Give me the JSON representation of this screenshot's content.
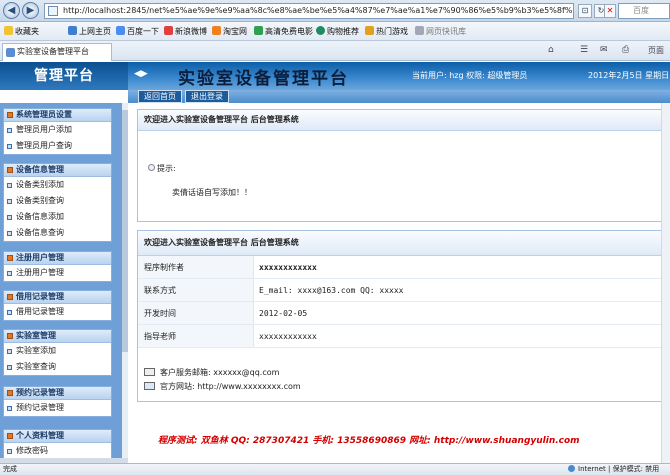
{
  "browser": {
    "url": "http://localhost:2845/net%e5%ae%9e%e9%aa%8c%e8%ae%be%e5%a4%87%e7%ae%a1%e7%90%86%e5%b9%b3%e5%8f%b0sh",
    "search_placeholder": "百度",
    "tab_title": "实验室设备管理平台",
    "favorites_label": "收藏夹",
    "favorites": [
      "上网主页",
      "百度一下",
      "新浪微博",
      "淘宝网",
      "高清免费电影",
      "购物推荐",
      "热门游戏",
      "网页快讯库"
    ],
    "page_menu": "页面",
    "status_left": "完成",
    "status_zone": "Internet | 保护模式: 禁用"
  },
  "app": {
    "logo": "管理平台",
    "system_name": "实验室设备管理平台",
    "user_info": "当前用户: hzg  权限: 超级管理员",
    "date_info": "2012年2月5日  星期日",
    "sub_buttons": [
      "返回首页",
      "退出登录"
    ]
  },
  "sidebar": {
    "groups": [
      {
        "title": "系统管理员设置",
        "items": [
          "管理员用户添加",
          "管理员用户查询"
        ]
      },
      {
        "title": "设备信息管理",
        "items": [
          "设备类别添加",
          "设备类别查询",
          "设备信息添加",
          "设备信息查询"
        ]
      },
      {
        "title": "注册用户管理",
        "items": [
          "注册用户管理"
        ]
      },
      {
        "title": "借用记录管理",
        "items": [
          "借用记录管理"
        ]
      },
      {
        "title": "实验室管理",
        "items": [
          "实验室添加",
          "实验室查询"
        ]
      },
      {
        "title": "预约记录管理",
        "items": [
          "预约记录管理"
        ]
      },
      {
        "title": "个人资料管理",
        "items": [
          "修改密码"
        ]
      }
    ]
  },
  "content": {
    "panel1": {
      "title": "欢迎进入实验室设备管理平台 后台管理系统",
      "tip_label": "提示:",
      "tip_message": "卖倩话语自写添加！！"
    },
    "panel2": {
      "title": "欢迎进入实验室设备管理平台 后台管理系统",
      "rows": [
        {
          "label": "程序制作者",
          "value": "xxxxxxxxxxxx"
        },
        {
          "label": "联系方式",
          "value": "E_mail: xxxx@163.com QQ: xxxxx"
        },
        {
          "label": "开发时间",
          "value": "2012-02-05"
        },
        {
          "label": "指导老师",
          "value": "xxxxxxxxxxxx"
        }
      ],
      "service_email": "客户服务邮箱: xxxxxx@qq.com",
      "website": "官方网站: http://www.xxxxxxxx.com"
    },
    "footer": "程序测试: 双鱼林    QQ: 287307421    手机: 13558690869    网址: http://www.shuangyulin.com"
  }
}
